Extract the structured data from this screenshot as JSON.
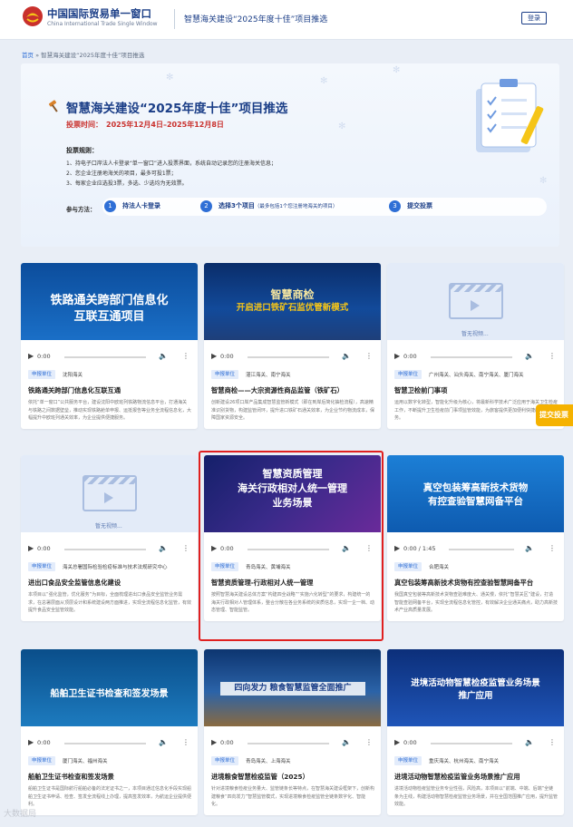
{
  "header": {
    "logo_cn": "中国国际贸易单一窗口",
    "logo_en": "China International Trade Single Window",
    "title": "智慧海关建设“2025年度十佳”项目推选",
    "login": "登录"
  },
  "breadcrumb": {
    "home": "首页",
    "sep": "»",
    "current": "智慧海关建设“2025年度十佳”项目推选"
  },
  "banner": {
    "title": "智慧海关建设“2025年度十佳”项目推选",
    "time_label": "投票时间：",
    "time": "2025年12月4日–2025年12月8日",
    "rules_title": "投票规则：",
    "rules": [
      "1、持电子口岸法人卡登录“单一窗口”进入投票界面，系统自动记录您的注册海关信息；",
      "2、您企业注册地海关的项目，最多可投1票；",
      "3、每家企业应选投3票，多选、少选均为无效票。"
    ],
    "method_label": "参与方法：",
    "steps": [
      {
        "num": "1",
        "text": "持法人卡登录",
        "sub": ""
      },
      {
        "num": "2",
        "text": "选择3个项目",
        "sub": "（最多包括1个您注册地海关的项目）"
      },
      {
        "num": "3",
        "text": "提交投票",
        "sub": ""
      }
    ]
  },
  "cards": [
    {
      "thumb_lines": [
        "铁路通关跨部门信息化",
        "互联互通项目"
      ],
      "time": "0:00",
      "badge": "申报单位",
      "units": "沈阳海关",
      "title": "铁路通关跨部门信息化互联互通",
      "desc": "依托“单一窗口”公共服务平台，建设沈阳中欧班列铁路物流信息平台，打通海关与铁路之间数据壁垒，推动实现铁路舱单申报、运抵报告等业务全流程信息化，大幅提升中欧班列通关效率，为企业提供便捷服务。"
    },
    {
      "thumb_lines": [
        "智慧商检",
        "开启进口铁矿石监优管新模式"
      ],
      "time": "0:00",
      "badge": "申报单位",
      "units": "湛江海关、南宁海关",
      "title": "智慧商检——大宗资源性商品监管（铁矿石）",
      "desc": "创新建设26项口岸产品集成智慧监管新模式（即在到岸后简化抽检流程），高速精准识别货物，构建监管闭环，提升进口铁矿石通关效率，为企业节约物流成本，保障国家资源安全。"
    },
    {
      "placeholder": "暂无视频...",
      "time": "0:00",
      "badge": "申报单位",
      "units": "广州海关、汕头海关、南宁海关、厦门海关",
      "title": "智慧卫检前门事项",
      "desc": "运用以数字化转型，智能化升级为核心，将最新科学技术广泛应用于海关卫生检疫工作，不断提升卫生检疫前门事项监管效能，为旅客提供更加便利快捷的通关服务。"
    },
    {
      "placeholder": "暂无视频...",
      "time": "0:00",
      "badge": "申报单位",
      "units": "海关总署国际检验检疫标准与技术法规研究中心",
      "title": "进出口食品安全监管信息化建设",
      "desc": "本项目以“强化监管，优化服务”为目标，全面梳理进出口食品安全监管业务需求，在总署层面从顶层设计和系统建设两方面推进，实现全流程信息化监管，有效提升食品安全监管效能。"
    },
    {
      "thumb_lines": [
        "智慧资质管理",
        "海关行政相对人统一管理",
        "业务场景"
      ],
      "time": "0:00",
      "badge": "申报单位",
      "units": "青岛海关、黄埔海关",
      "title": "智慧资质管理-行政相对人统一管理",
      "desc": "按照智慧海关建设总体方案“构建四全战略”“实施六化转型”的要求，构建统一的海关行政相对人管理体系，整合分散在各业务系统的资质信息，实现一企一档、动态管理、智能监管。"
    },
    {
      "thumb_lines": [
        "真空包装筹高新技术货物",
        "有控查验智慧网备平台"
      ],
      "time": "0:00 / 1:45",
      "badge": "申报单位",
      "units": "合肥海关",
      "title": "真空包装筹高新技术货物有控查验智慧网备平台",
      "desc": "我国真空包装等高新技术货物查验难度大、通关慢，依托“智慧关区”建设，打造智能查验网备平台，实现全流程信息化管控，有效解决企业通关痛点，助力高新技术产业高质量发展。"
    },
    {
      "thumb_lines": [
        "船舶卫生证书检查和签发场景"
      ],
      "time": "0:00",
      "badge": "申报单位",
      "units": "厦门海关、福州海关",
      "title": "船舶卫生证书检查和签发场景",
      "desc": "船舶卫生证书是国际航行船舶必备的法定证书之一，本项目通过信息化手段实现船舶卫生证书申请、检查、签发全流程线上办理，提高签发效率，为航运企业提供便利。"
    },
    {
      "thumb_lines": [
        "四向发力 粮食智慧监管全面推广"
      ],
      "time": "0:00",
      "badge": "申报单位",
      "units": "青岛海关、上海海关",
      "title": "进境粮食智慧检疫监管（2025）",
      "desc": "针对进境粮食检疫业务量大、监管链条长等特点，在智慧海关建设框架下，创新构建粮食“四向发力”智慧监管模式，实现进境粮食检疫监管全链条数字化、智能化。"
    },
    {
      "thumb_lines": [
        "进境活动物智慧检疫监管业务场景",
        "推广应用"
      ],
      "time": "0:00",
      "badge": "申报单位",
      "units": "重庆海关、杭州海关、南宁海关",
      "title": "进境活动物智慧检疫监管业务场景推广应用",
      "desc": "进境活动物检疫监管业务专业性强，风险高，本项目以“前端、中端、后端”全链条为主线，构建活动物智慧检疫监管业务场景，并在全国范围推广应用，提升监管效能。"
    }
  ],
  "float_vote": "提交投票",
  "watermark": "大数据局"
}
